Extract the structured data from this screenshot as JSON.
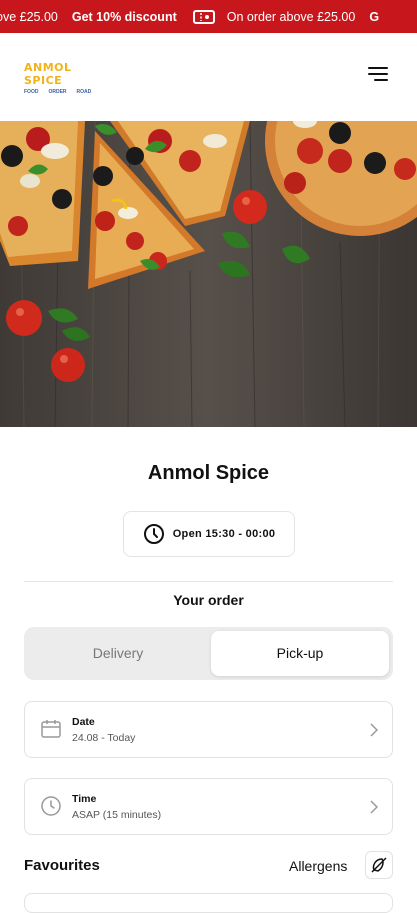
{
  "promo": {
    "segments": [
      "ove £25.00",
      "Get 10% discount",
      "On order above £25.00",
      "G"
    ],
    "ticket_icon": "ticket-icon"
  },
  "header": {
    "logo_text": "ANMOL SPICE",
    "logo_sub": [
      "FOOD",
      "ORDER",
      "ROAD"
    ],
    "menu_icon": "hamburger-menu-icon"
  },
  "hero": {
    "image": "pizza slices on wooden table"
  },
  "restaurant": {
    "name": "Anmol Spice",
    "hours": "Open 15:30 - 00:00"
  },
  "order": {
    "title": "Your order",
    "options": [
      "Delivery",
      "Pick-up"
    ],
    "selected": "Pick-up"
  },
  "date": {
    "title": "Date",
    "value": "24.08 - Today"
  },
  "time": {
    "title": "Time",
    "value": "ASAP (15 minutes)"
  },
  "favourites": {
    "title": "Favourites",
    "allergens_label": "Allergens"
  },
  "colors": {
    "promo_bg": "#c8161d",
    "logo_yellow": "#f2b21a",
    "logo_blue": "#3a5ea8"
  }
}
